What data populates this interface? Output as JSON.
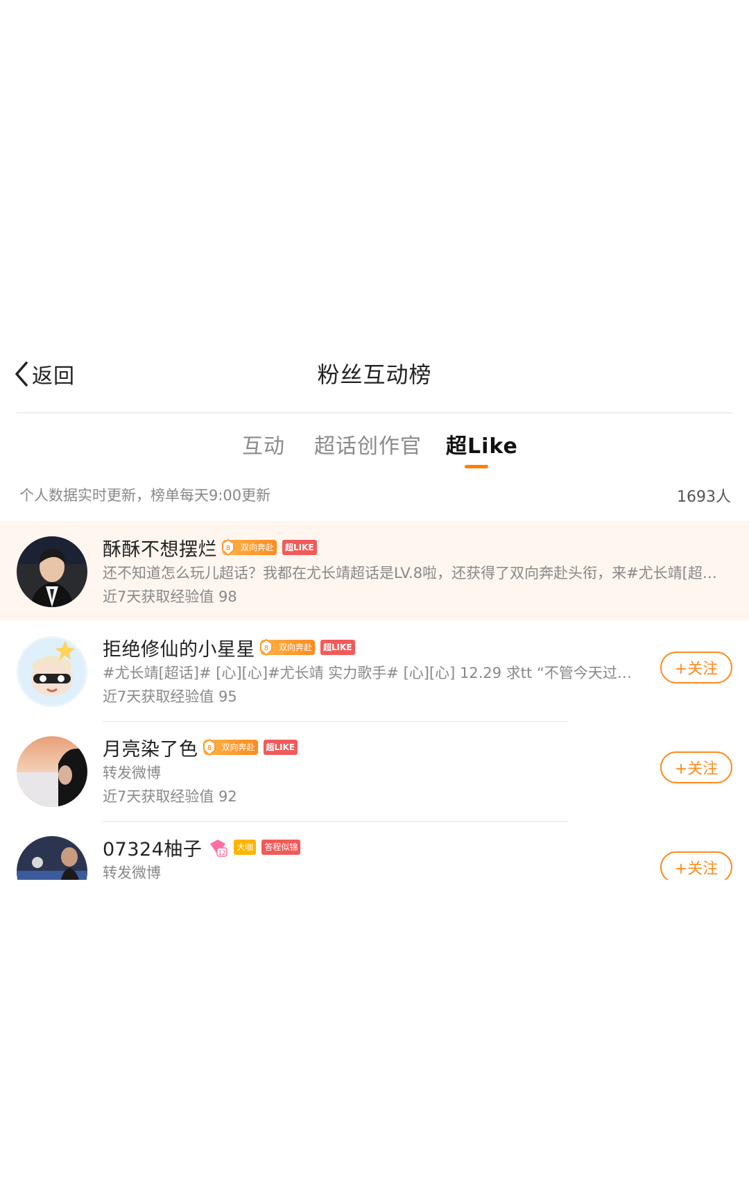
{
  "header": {
    "back_label": "返回",
    "title": "粉丝互动榜"
  },
  "tabs": [
    {
      "label": "互动",
      "active": false
    },
    {
      "label": "超话创作官",
      "active": false
    },
    {
      "label": "超Like",
      "active": true
    }
  ],
  "info": {
    "update_note": "个人数据实时更新，榜单每天9:00更新",
    "count": "1693人"
  },
  "list": [
    {
      "username": "酥酥不想摆烂",
      "badges": {
        "dual": "双向奔赴",
        "like": "超LIKE",
        "level": "8"
      },
      "desc": "还不知道怎么玩儿超话？我都在尤长靖超话是LV.8啦，还获得了双向奔赴头衔，来#尤长靖[超…",
      "exp": "近7天获取经验值 98",
      "highlight": true
    },
    {
      "username": "拒绝修仙的小星星",
      "badges": {
        "dual": "双向奔赴",
        "like": "超LIKE",
        "level": "8"
      },
      "desc": "#尤长靖[超话]# [心][心]#尤长靖 实力歌手# [心][心] 12.29 求tt “不管今天过得怎…",
      "exp": "近7天获取经验值 95",
      "follow": "+关注"
    },
    {
      "username": "月亮染了色",
      "badges": {
        "dual": "双向奔赴",
        "like": "超LIKE",
        "level": "8"
      },
      "desc": "转发微博",
      "exp": "近7天获取经验值 92",
      "follow": "+关注"
    },
    {
      "username": "07324柚子",
      "badges": {
        "level": "12",
        "big": "大咖",
        "red": "答程似锦"
      },
      "desc": "转发微博",
      "follow": "+关注"
    }
  ],
  "colors": {
    "accent": "#ff8a1f",
    "highlight_bg": "#fef6ef",
    "like_badge": "#f25a5a"
  }
}
